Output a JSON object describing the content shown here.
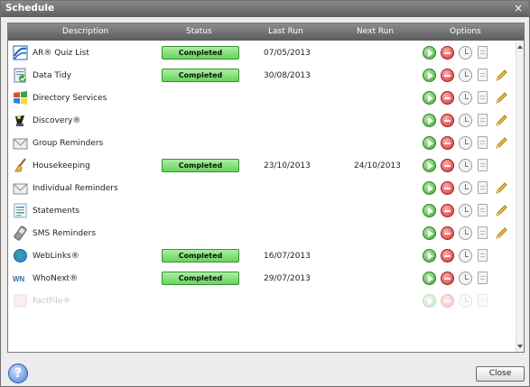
{
  "window": {
    "title": "Schedule",
    "close_glyph": "×",
    "close_icon": "close-icon"
  },
  "columns": {
    "description": "Description",
    "status": "Status",
    "last_run": "Last Run",
    "next_run": "Next Run",
    "options": "Options"
  },
  "colors": {
    "completed": "#68d35c",
    "run": "#3da52f",
    "stop": "#d72d2d",
    "header": "#5c5c5c"
  },
  "rows": [
    {
      "description": "AR® Quiz List",
      "icon": "ar-quiz-list-icon",
      "status": "Completed",
      "last_run": "07/05/2013",
      "next_run": "",
      "editable": false
    },
    {
      "description": "Data Tidy",
      "icon": "data-tidy-icon",
      "status": "Completed",
      "last_run": "30/08/2013",
      "next_run": "",
      "editable": true
    },
    {
      "description": "Directory Services",
      "icon": "windows-logo-icon",
      "status": "",
      "last_run": "",
      "next_run": "",
      "editable": true
    },
    {
      "description": "Discovery®",
      "icon": "discovery-icon",
      "status": "",
      "last_run": "",
      "next_run": "",
      "editable": true
    },
    {
      "description": "Group Reminders",
      "icon": "envelope-icon",
      "status": "",
      "last_run": "",
      "next_run": "",
      "editable": true
    },
    {
      "description": "Housekeeping",
      "icon": "broom-icon",
      "status": "Completed",
      "last_run": "23/10/2013",
      "next_run": "24/10/2013",
      "editable": false
    },
    {
      "description": "Individual Reminders",
      "icon": "envelope-icon",
      "status": "",
      "last_run": "",
      "next_run": "",
      "editable": true
    },
    {
      "description": "Statements",
      "icon": "statement-icon",
      "status": "",
      "last_run": "",
      "next_run": "",
      "editable": true
    },
    {
      "description": "SMS Reminders",
      "icon": "mobile-phone-icon",
      "status": "",
      "last_run": "",
      "next_run": "",
      "editable": true
    },
    {
      "description": "WebLinks®",
      "icon": "globe-icon",
      "status": "Completed",
      "last_run": "16/07/2013",
      "next_run": "",
      "editable": false
    },
    {
      "description": "WhoNext®",
      "icon": "whonext-icon",
      "status": "Completed",
      "last_run": "29/07/2013",
      "next_run": "",
      "editable": false
    },
    {
      "description": "FactFile®",
      "icon": "factfile-icon",
      "status": "",
      "last_run": "",
      "next_run": "",
      "editable": false,
      "faded": true
    }
  ],
  "footer": {
    "help_glyph": "?",
    "close_label": "Close"
  }
}
